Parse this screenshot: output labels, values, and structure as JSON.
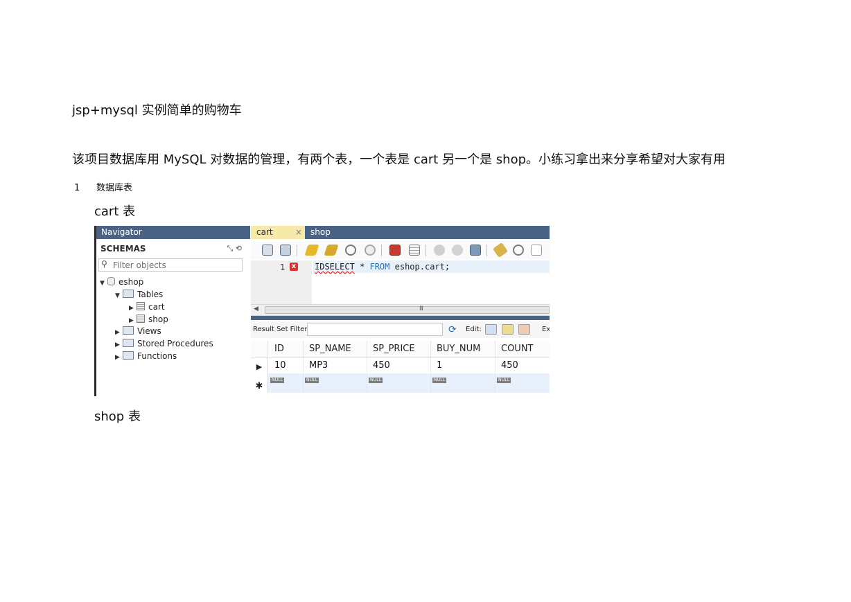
{
  "doc": {
    "title": "jsp+mysql 实例简单的购物车",
    "intro": "该项目数据库用 MySQL 对数据的管理，有两个表，一个表是 cart 另一个是 shop。小练习拿出来分享希望对大家有用",
    "section_number": "1",
    "section_title": "数据库表",
    "cart_caption": "cart 表",
    "shop_caption": "shop 表"
  },
  "workbench": {
    "navigator": {
      "header": "Navigator",
      "schemas_label": "SCHEMAS",
      "filter_placeholder": "Filter objects",
      "tree": {
        "schema": "eshop",
        "tables_label": "Tables",
        "tables": [
          "cart",
          "shop"
        ],
        "views_label": "Views",
        "procedures_label": "Stored Procedures",
        "functions_label": "Functions"
      }
    },
    "tabs": [
      {
        "label": "cart",
        "active": true
      },
      {
        "label": "shop",
        "active": false
      }
    ],
    "tab_close_glyph": "×",
    "editor": {
      "line_number": "1",
      "error_glyph": "x",
      "code_error_part": "IDSELECT",
      "code_op": " * ",
      "code_kw": "FROM",
      "code_rest": " eshop.cart;",
      "scroll_grip": "III"
    },
    "result": {
      "filter_label": "Result Set Filter:",
      "edit_label": "Edit:",
      "export_label": "Ex",
      "columns": [
        "ID",
        "SP_NAME",
        "SP_PRICE",
        "BUY_NUM",
        "COUNT"
      ],
      "row": [
        "10",
        "MP3",
        "450",
        "1",
        "450"
      ],
      "null_label": "NULL",
      "current_row_marker": "▶",
      "new_row_marker": "✱"
    },
    "colors": {
      "header_bg": "#4a6384",
      "active_tab_bg": "#f7e9a9",
      "keyword": "#1f6fc2",
      "error": "#d9342b"
    }
  }
}
